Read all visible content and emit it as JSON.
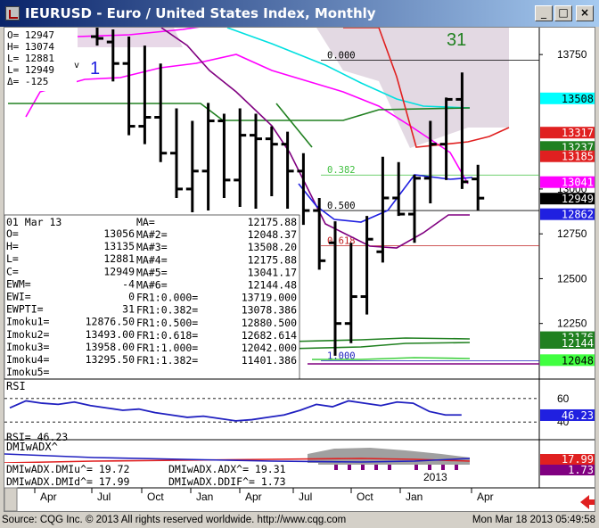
{
  "window": {
    "title": "IEURUSD - Euro / United States Index, Monthly",
    "minimize_label": "_",
    "maximize_label": "□",
    "close_label": "×"
  },
  "ohlc_box": {
    "o": "O=   12947",
    "h": "H=   13074",
    "l": "L=   12881",
    "last": "L=   12949",
    "last_marker": "v",
    "delta": "Δ=    -125",
    "wave_count": "1"
  },
  "elliott_label": "31",
  "price_axis": {
    "ticks": [
      {
        "label": "13750",
        "value": 13750
      },
      {
        "label": "13000",
        "value": 13000
      },
      {
        "label": "12750",
        "value": 12750
      },
      {
        "label": "12500",
        "value": 12500
      },
      {
        "label": "12250",
        "value": 12250
      }
    ],
    "badges": [
      {
        "label": "13508",
        "value": 13508,
        "bg": "#00ffff",
        "fg": "#000000"
      },
      {
        "label": "13317",
        "value": 13317,
        "bg": "#e02020",
        "fg": "#ffffff"
      },
      {
        "label": "13237",
        "value": 13237,
        "bg": "#208020",
        "fg": "#ffffff"
      },
      {
        "label": "13185",
        "value": 13185,
        "bg": "#e02020",
        "fg": "#ffffff"
      },
      {
        "label": "13041",
        "value": 13041,
        "bg": "#ff00ff",
        "fg": "#ffffff"
      },
      {
        "label": "12949",
        "value": 12949,
        "bg": "#000000",
        "fg": "#ffffff"
      },
      {
        "label": "12862",
        "value": 12862,
        "bg": "#2020e0",
        "fg": "#ffffff"
      },
      {
        "label": "12176",
        "value": 12176,
        "bg": "#208020",
        "fg": "#ffffff"
      },
      {
        "label": "12144",
        "value": 12144,
        "bg": "#208020",
        "fg": "#ffffff"
      },
      {
        "label": "12048",
        "value": 12048,
        "bg": "#40ff40",
        "fg": "#000000"
      }
    ]
  },
  "fib_levels": [
    {
      "label": "0.000",
      "value": 13719,
      "color": "#000000"
    },
    {
      "label": "0.382",
      "value": 13078,
      "color": "#40c040"
    },
    {
      "label": "0.500",
      "value": 12880,
      "color": "#000000"
    },
    {
      "label": "0.618",
      "value": 12683,
      "color": "#c02020"
    },
    {
      "label": "1.000",
      "value": 12042,
      "color": "#2020c0"
    }
  ],
  "data_box": {
    "date": "01 Mar 13",
    "rows_left": [
      {
        "k": "O=",
        "v": "13056"
      },
      {
        "k": "H=",
        "v": "13135"
      },
      {
        "k": "L=",
        "v": "12881"
      },
      {
        "k": "C=",
        "v": "12949"
      },
      {
        "k": "EWM=",
        "v": "-4"
      },
      {
        "k": "EWI=",
        "v": "0"
      },
      {
        "k": "EWPTI=",
        "v": "31"
      },
      {
        "k": "Imoku1=",
        "v": "12876.50"
      },
      {
        "k": "Imoku2=",
        "v": "13493.00"
      },
      {
        "k": "Imoku3=",
        "v": "13958.00"
      },
      {
        "k": "Imoku4=",
        "v": "13295.50"
      },
      {
        "k": "Imoku5=",
        "v": ""
      }
    ],
    "rows_right": [
      {
        "k": "MA=",
        "v": "12175.88"
      },
      {
        "k": "MA#2=",
        "v": "12048.37"
      },
      {
        "k": "MA#3=",
        "v": "13508.20"
      },
      {
        "k": "MA#4=",
        "v": "12175.88"
      },
      {
        "k": "MA#5=",
        "v": "13041.17"
      },
      {
        "k": "MA#6=",
        "v": "12144.48"
      },
      {
        "k": "FR1:0.000=",
        "v": "13719.000"
      },
      {
        "k": "FR1:0.382=",
        "v": "13078.386"
      },
      {
        "k": "FR1:0.500=",
        "v": "12880.500"
      },
      {
        "k": "FR1:0.618=",
        "v": "12682.614"
      },
      {
        "k": "FR1:1.000=",
        "v": "12042.000"
      },
      {
        "k": "FR1:1.382=",
        "v": "11401.386"
      }
    ]
  },
  "rsi": {
    "title": "RSI",
    "readout": "RSI=   46.23",
    "ticks": [
      {
        "label": "60",
        "value": 60
      },
      {
        "label": "40",
        "value": 40
      }
    ],
    "badge": "46.23",
    "series": [
      52,
      58,
      56,
      55,
      57,
      54,
      52,
      50,
      51,
      48,
      46,
      44,
      45,
      43,
      41,
      42,
      44,
      46,
      50,
      55,
      53,
      58,
      56,
      54,
      57,
      56,
      49,
      46,
      46
    ]
  },
  "dmi": {
    "title": "DMIwADX^",
    "readout_1": "DMIwADX.DMIu^=    19.72",
    "readout_2": "DMIwADX.DMId^=    17.99",
    "readout_3": "DMIwADX.ADX^=    19.31",
    "readout_4": "DMIwADX.DDIF^=    1.73",
    "badges": [
      {
        "label": "17.99",
        "bg": "#e02020",
        "fg": "#ffffff"
      },
      {
        "label": "1.73",
        "bg": "#800080",
        "fg": "#ffffff"
      }
    ]
  },
  "time_axis": [
    "Apr",
    "Jul",
    "Oct",
    "Jan",
    "Apr",
    "Jul",
    "Oct",
    "Jan",
    "Apr"
  ],
  "year_label": "2013",
  "chart_data": {
    "type": "bar",
    "title": "IEURUSD - Euro / United States Index, Monthly",
    "ylim": [
      11950,
      13900
    ],
    "bars": [
      {
        "o": 13850,
        "h": 13900,
        "l": 13800,
        "c": 13840
      },
      {
        "o": 13820,
        "h": 13890,
        "l": 13600,
        "c": 13700
      },
      {
        "o": 13700,
        "h": 13850,
        "l": 13300,
        "c": 13350
      },
      {
        "o": 13350,
        "h": 13800,
        "l": 13250,
        "c": 13400
      },
      {
        "o": 13400,
        "h": 13700,
        "l": 13150,
        "c": 13200
      },
      {
        "o": 13200,
        "h": 13450,
        "l": 12950,
        "c": 13000
      },
      {
        "o": 13000,
        "h": 13380,
        "l": 12870,
        "c": 13100
      },
      {
        "o": 13100,
        "h": 13480,
        "l": 12880,
        "c": 13380
      },
      {
        "o": 13380,
        "h": 13420,
        "l": 12950,
        "c": 13050
      },
      {
        "o": 13050,
        "h": 13450,
        "l": 12900,
        "c": 13300
      },
      {
        "o": 13300,
        "h": 13420,
        "l": 12890,
        "c": 13280
      },
      {
        "o": 13280,
        "h": 13350,
        "l": 12960,
        "c": 13250
      },
      {
        "o": 13250,
        "h": 13320,
        "l": 12890,
        "c": 13100
      },
      {
        "o": 13100,
        "h": 13200,
        "l": 12800,
        "c": 12880
      },
      {
        "o": 12880,
        "h": 12950,
        "l": 12550,
        "c": 12600
      },
      {
        "o": 12700,
        "h": 12820,
        "l": 12070,
        "c": 12250
      },
      {
        "o": 12250,
        "h": 12700,
        "l": 12140,
        "c": 12400
      },
      {
        "o": 12400,
        "h": 12850,
        "l": 12300,
        "c": 12720
      },
      {
        "o": 12650,
        "h": 13180,
        "l": 12590,
        "c": 12950
      },
      {
        "o": 12950,
        "h": 13150,
        "l": 12850,
        "c": 12860
      },
      {
        "o": 12860,
        "h": 13080,
        "l": 12700,
        "c": 13060
      },
      {
        "o": 13060,
        "h": 13380,
        "l": 12920,
        "c": 13250
      },
      {
        "o": 13250,
        "h": 13510,
        "l": 13050,
        "c": 13500
      },
      {
        "o": 13500,
        "h": 13650,
        "l": 13000,
        "c": 13040
      },
      {
        "o": 13056,
        "h": 13135,
        "l": 12881,
        "c": 12949
      }
    ]
  }
}
